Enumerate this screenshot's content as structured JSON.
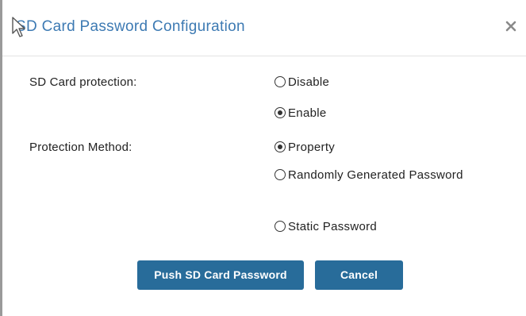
{
  "dialog": {
    "title": "SD Card Password Configuration",
    "close_symbol": "×"
  },
  "form": {
    "protection": {
      "label": "SD Card protection:",
      "options": [
        {
          "label": "Disable",
          "selected": false
        },
        {
          "label": "Enable",
          "selected": true
        }
      ]
    },
    "method": {
      "label": "Protection Method:",
      "options": [
        {
          "label": "Property",
          "selected": true
        },
        {
          "label": "Randomly Generated Password",
          "selected": false
        },
        {
          "label": "Static Password",
          "selected": false
        }
      ]
    }
  },
  "buttons": {
    "push_label": "Push SD Card Password",
    "cancel_label": "Cancel"
  },
  "colors": {
    "title": "#3d7ab3",
    "button_bg": "#286c9a",
    "button_text": "#ffffff"
  },
  "icons": {
    "close": "close-icon",
    "cursor": "mouse-pointer-icon"
  }
}
